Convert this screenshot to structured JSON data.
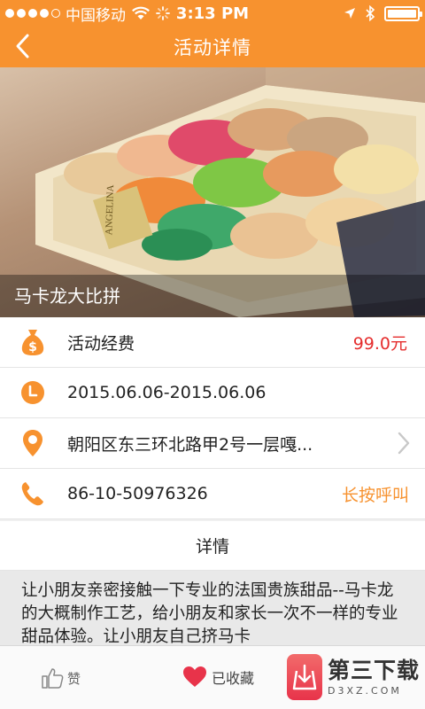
{
  "status_bar": {
    "carrier": "中国移动",
    "time": "3:13 PM"
  },
  "nav": {
    "title": "活动详情"
  },
  "hero": {
    "caption": "马卡龙大比拼",
    "box_text": "ANGELINA"
  },
  "info": {
    "fee_label": "活动经费",
    "fee_value": "99.0元",
    "date": "2015.06.06-2015.06.06",
    "address": "朝阳区东三环北路甲2号一层嘎...",
    "phone": "86-10-50976326",
    "call_label": "长按呼叫"
  },
  "detail": {
    "header": "详情",
    "body": "让小朋友亲密接触一下专业的法国贵族甜品--马卡龙的大概制作工艺，给小朋友和家长一次不一样的专业甜品体验。让小朋友自己挤马卡"
  },
  "bottom": {
    "like_label": "赞",
    "fav_label": "已收藏",
    "brand_name": "第三下载",
    "brand_sub": "D3XZ.COM"
  },
  "colors": {
    "accent": "#f7922f",
    "price": "#e52d2d",
    "favorite": "#e8334a"
  }
}
